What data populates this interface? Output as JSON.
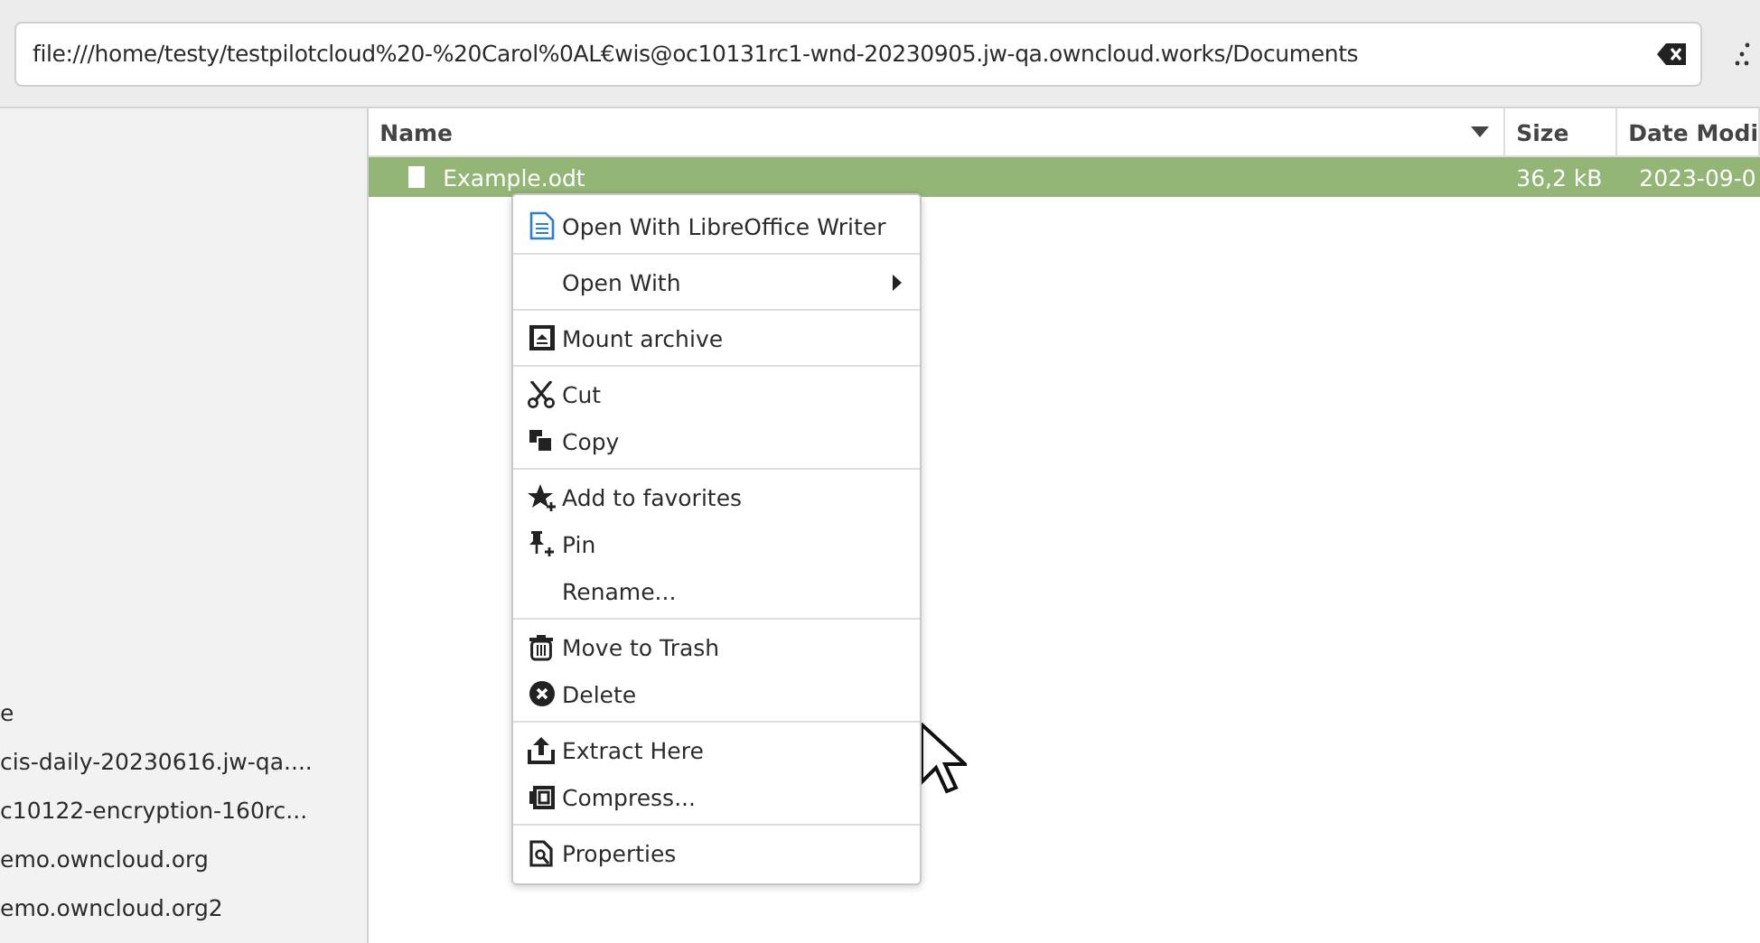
{
  "location": {
    "value": "file:///home/testy/testpilotcloud%20-%20Carol%0AL€wis@oc10131rc1-wnd-20230905.jw-qa.owncloud.works/Documents"
  },
  "sidebar": {
    "items": [
      {
        "label": "e"
      },
      {
        "label": "cis-daily-20230616.jw-qa...."
      },
      {
        "label": "c10122-encryption-160rc..."
      },
      {
        "label": "emo.owncloud.org"
      },
      {
        "label": "emo.owncloud.org2"
      }
    ]
  },
  "table": {
    "columns": [
      {
        "label": "Name",
        "sorted": true
      },
      {
        "label": "Size",
        "sorted": false
      },
      {
        "label": "Date Modi",
        "sorted": false
      }
    ],
    "rows": [
      {
        "name": "Example.odt",
        "size": "36,2 kB",
        "date": "2023-09-0",
        "selected": true
      }
    ]
  },
  "context_menu": {
    "groups": [
      [
        {
          "label": "Open With LibreOffice Writer",
          "kind": "writer",
          "submenu": false
        }
      ],
      [
        {
          "label": "Open With",
          "kind": "plain",
          "submenu": true
        }
      ],
      [
        {
          "label": "Mount archive",
          "kind": "mount",
          "submenu": false
        }
      ],
      [
        {
          "label": "Cut",
          "kind": "cut",
          "submenu": false
        },
        {
          "label": "Copy",
          "kind": "copy",
          "submenu": false
        }
      ],
      [
        {
          "label": "Add to favorites",
          "kind": "star",
          "submenu": false
        },
        {
          "label": "Pin",
          "kind": "pin",
          "submenu": false
        },
        {
          "label": "Rename...",
          "kind": "plain",
          "submenu": false
        }
      ],
      [
        {
          "label": "Move to Trash",
          "kind": "trash",
          "submenu": false
        },
        {
          "label": "Delete",
          "kind": "delete",
          "submenu": false
        }
      ],
      [
        {
          "label": "Extract Here",
          "kind": "extract",
          "submenu": false
        },
        {
          "label": "Compress...",
          "kind": "compress",
          "submenu": false
        }
      ],
      [
        {
          "label": "Properties",
          "kind": "properties",
          "submenu": false
        }
      ]
    ]
  }
}
